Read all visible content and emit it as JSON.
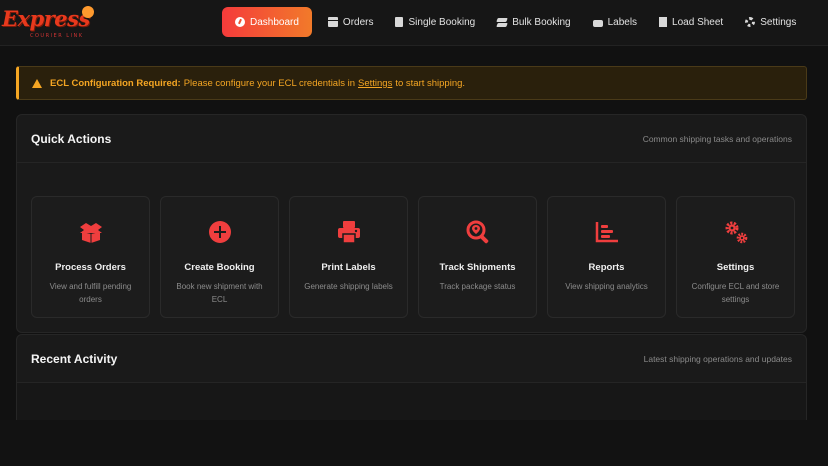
{
  "logo": {
    "text": "Express",
    "tagline": "COURIER LINK"
  },
  "nav": {
    "items": [
      {
        "label": "Dashboard",
        "icon": "dashboard-icon",
        "active": true
      },
      {
        "label": "Orders",
        "icon": "box-icon"
      },
      {
        "label": "Single Booking",
        "icon": "file-icon"
      },
      {
        "label": "Bulk Booking",
        "icon": "layers-icon"
      },
      {
        "label": "Labels",
        "icon": "printer-icon"
      },
      {
        "label": "Load Sheet",
        "icon": "sheet-icon"
      },
      {
        "label": "Settings",
        "icon": "gear-icon"
      }
    ]
  },
  "alert": {
    "bold": "ECL Configuration Required:",
    "text_before": "Please configure your ECL credentials in",
    "link": "Settings",
    "text_after": "to start shipping.",
    "color": "#f5a623"
  },
  "quick_actions": {
    "title": "Quick Actions",
    "subtitle": "Common shipping tasks and operations",
    "cards": [
      {
        "name": "Process Orders",
        "desc": "View and fulfill pending orders",
        "icon": "box-open-icon"
      },
      {
        "name": "Create Booking",
        "desc": "Book new shipment with ECL",
        "icon": "plus-circle-icon"
      },
      {
        "name": "Print Labels",
        "desc": "Generate shipping labels",
        "icon": "printer-icon"
      },
      {
        "name": "Track Shipments",
        "desc": "Track package status",
        "icon": "search-location-icon"
      },
      {
        "name": "Reports",
        "desc": "View shipping analytics",
        "icon": "chart-icon"
      },
      {
        "name": "Settings",
        "desc": "Configure ECL and store settings",
        "icon": "gears-icon"
      }
    ]
  },
  "recent_activity": {
    "title": "Recent Activity",
    "subtitle": "Latest shipping operations and updates"
  },
  "colors": {
    "accent": "#ef3e3e",
    "accent_gradient_end": "#f27a2a",
    "background": "#111111",
    "panel": "#1a1a1a"
  }
}
